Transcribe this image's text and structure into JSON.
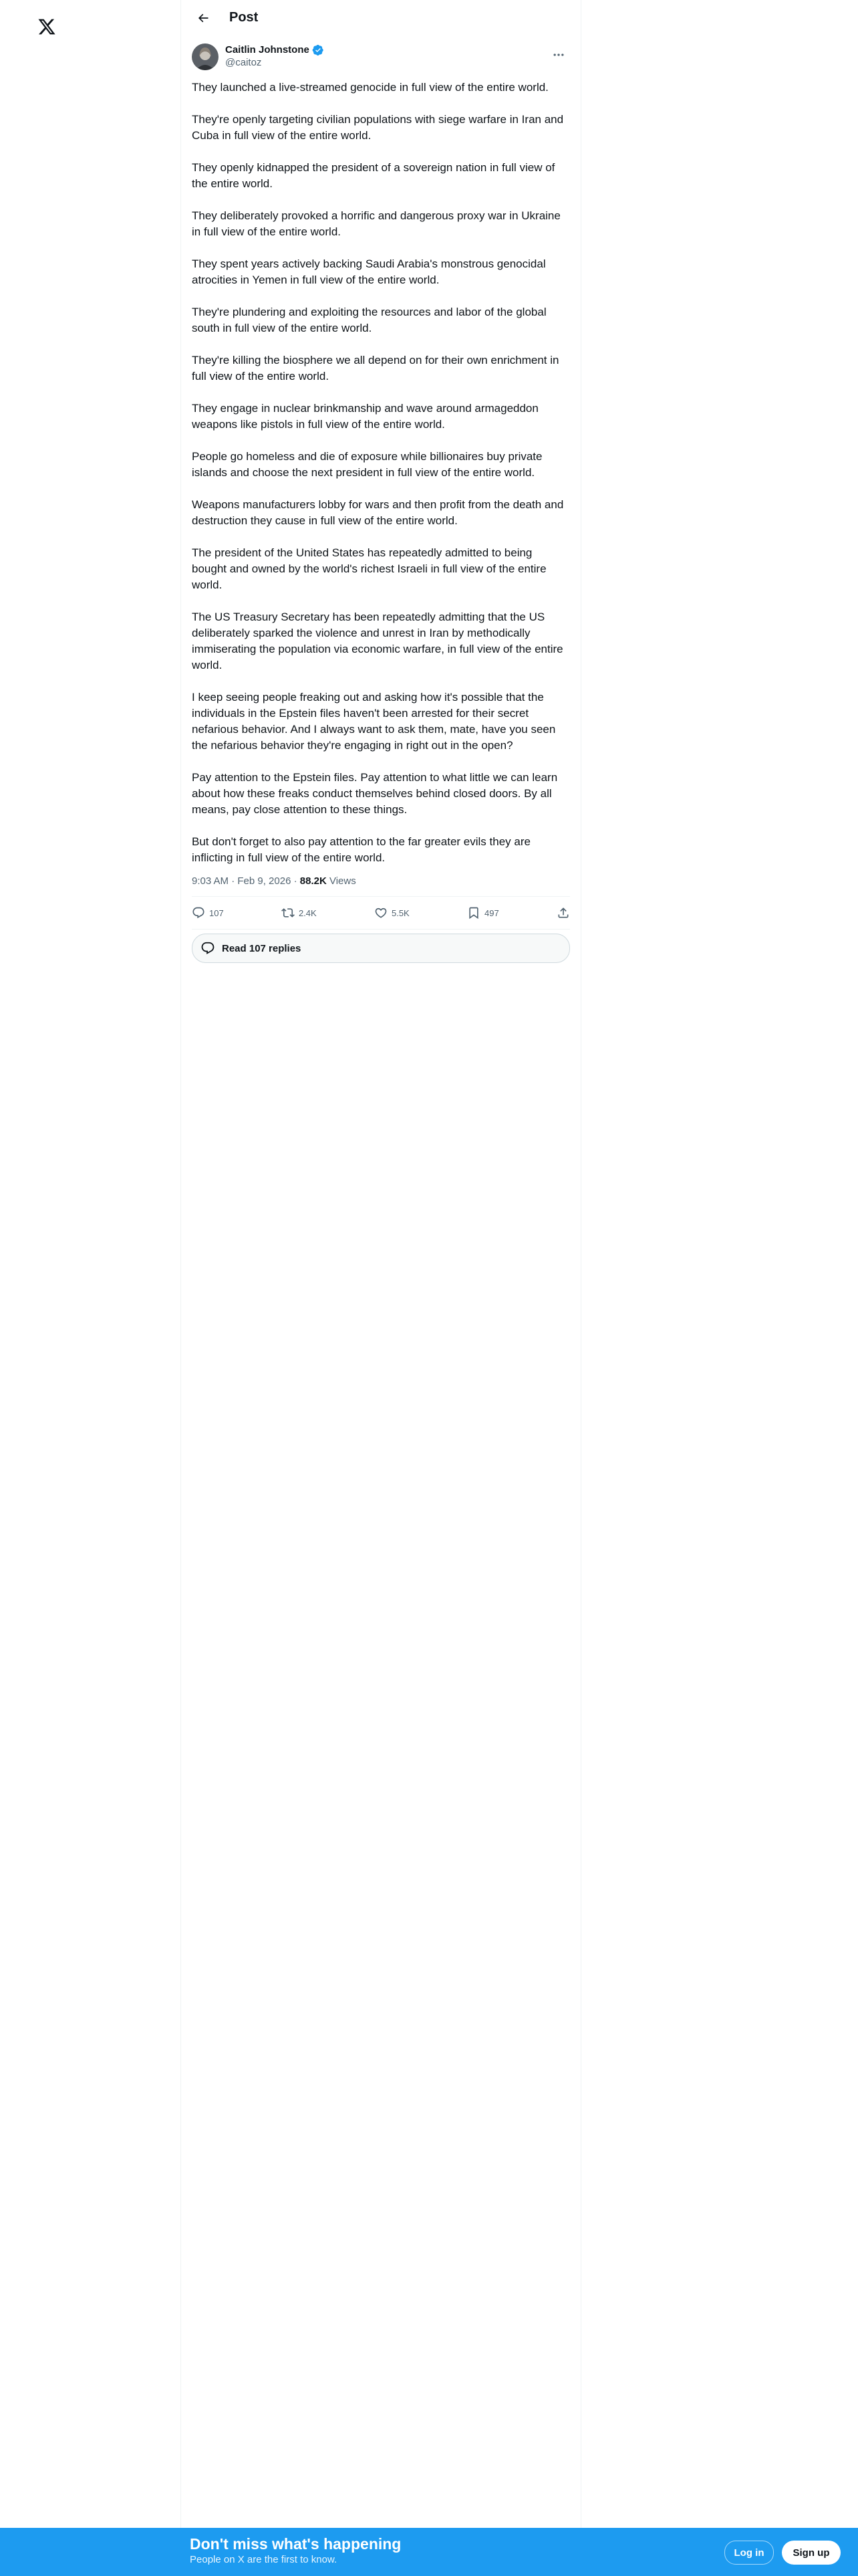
{
  "header": {
    "title": "Post"
  },
  "author": {
    "display_name": "Caitlin Johnstone",
    "handle": "@caitoz",
    "verified": true
  },
  "tweet": {
    "paragraphs": [
      "They launched a live-streamed genocide in full view of the entire world.",
      "They're openly targeting civilian populations with siege warfare in Iran and Cuba in full view of the entire world.",
      "They openly kidnapped the president of a sovereign nation in full view of the entire world.",
      "They deliberately provoked a horrific and dangerous proxy war in Ukraine in full view of the entire world.",
      "They spent years actively backing Saudi Arabia's monstrous genocidal atrocities in Yemen in full view of the entire world.",
      "They're plundering and exploiting the resources and labor of the global south in full view of the entire world.",
      "They're killing the biosphere we all depend on for their own enrichment in full view of the entire world.",
      "They engage in nuclear brinkmanship and wave around armageddon weapons like pistols in full view of the entire world.",
      "People go homeless and die of exposure while billionaires buy private islands and choose the next president in full view of the entire world.",
      "Weapons manufacturers lobby for wars and then profit from the death and destruction they cause in full view of the entire world.",
      "The president of the United States has repeatedly admitted to being bought and owned by the world's richest Israeli in full view of the entire world.",
      "The US Treasury Secretary has been repeatedly admitting that the US deliberately sparked the violence and unrest in Iran by methodically immiserating the population via economic warfare, in full view of the entire world.",
      "I keep seeing people freaking out and asking how it's possible that the individuals in the Epstein files haven't been arrested for their secret nefarious behavior. And I always want to ask them, mate, have you seen the nefarious behavior they're engaging in right out in the open?",
      "Pay attention to the Epstein files. Pay attention to what little we can learn about how these freaks conduct themselves behind closed doors. By all means, pay close attention to these things.",
      "But don't forget to also pay attention to the far greater evils they are inflicting in full view of the entire world."
    ],
    "timestamp": "9:03 AM · Feb 9, 2026 · ",
    "views_count": "88.2K",
    "views_label": " Views"
  },
  "actions": {
    "replies": "107",
    "reposts": "2.4K",
    "likes": "5.5K",
    "bookmarks": "497"
  },
  "read_replies": "Read 107 replies",
  "banner": {
    "headline": "Don't miss what's happening",
    "subtext": "People on X are the first to know.",
    "login": "Log in",
    "signup": "Sign up"
  },
  "colors": {
    "accent": "#1d9bf0",
    "text": "#0f1419",
    "muted": "#536471"
  }
}
